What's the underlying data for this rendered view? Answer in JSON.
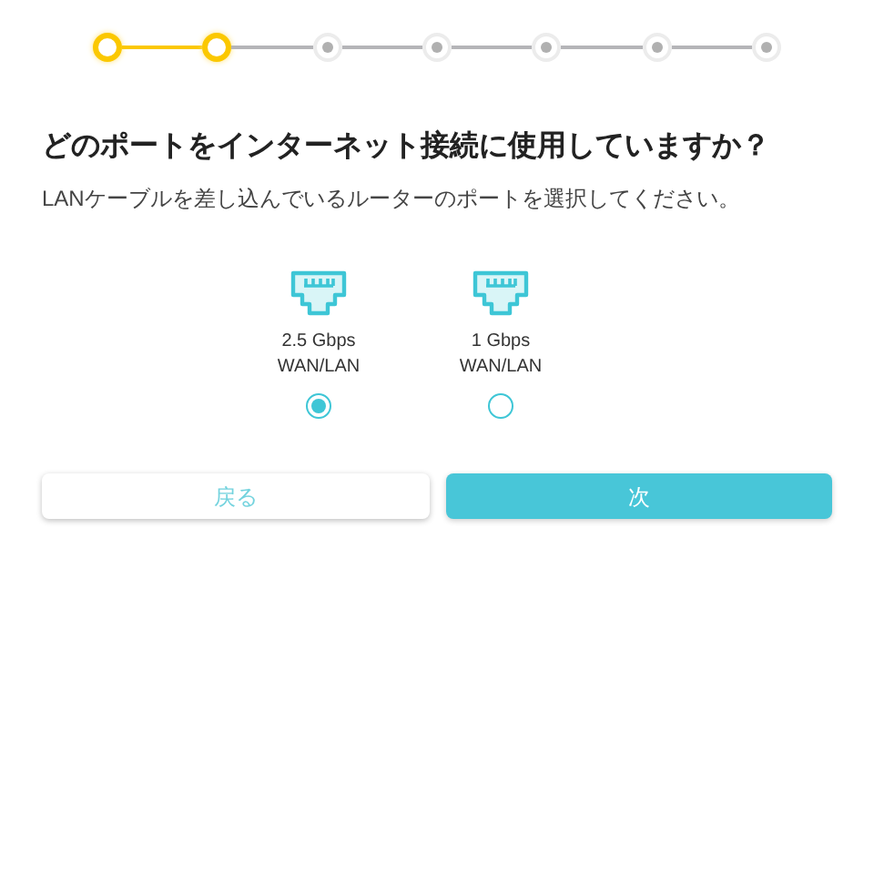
{
  "steps": [
    {
      "done": true
    },
    {
      "done": true
    },
    {
      "done": false
    },
    {
      "done": false
    },
    {
      "done": false
    },
    {
      "done": false
    },
    {
      "done": false
    }
  ],
  "title": "どのポートをインターネット接続に使用していますか？",
  "subtitle": "LANケーブルを差し込んでいるルーターのポートを選択してください。",
  "ports": [
    {
      "speed": "2.5 Gbps",
      "type": "WAN/LAN",
      "selected": true
    },
    {
      "speed": "1 Gbps",
      "type": "WAN/LAN",
      "selected": false
    }
  ],
  "buttons": {
    "back": "戻る",
    "next": "次"
  }
}
